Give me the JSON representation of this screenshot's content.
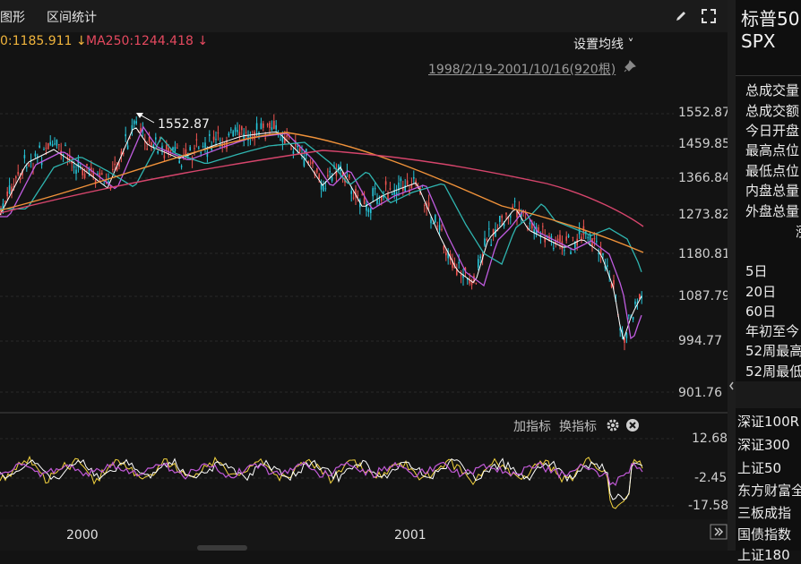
{
  "toolbar": {
    "tab_chart": "图形",
    "tab_range_stats": "区间统计",
    "draw_icon": "pencil-icon",
    "fullscreen_icon": "expand-icon"
  },
  "ma_legend": {
    "ma_prev": "0:1185.911 ↓",
    "ma250": "MA250:1244.418 ↓",
    "ma_prev_color": "#f0b43c",
    "ma250_color": "#e5495f"
  },
  "settings_ma": "设置均线 ˅",
  "date_range": "1998/2/19-2001/10/16(920根)",
  "high_marker": "1552.87",
  "price_axis": [
    "1552.87",
    "1459.85",
    "1366.84",
    "1273.82",
    "1180.81",
    "1087.79",
    "994.77",
    "901.76"
  ],
  "indicator": {
    "add_label": "加指标",
    "switch_label": "换指标",
    "axis": [
      "12.68",
      "-2.45",
      "-17.58"
    ]
  },
  "time_axis": [
    "2000",
    "2001"
  ],
  "right_panel": {
    "title": "标普50",
    "code": "SPX",
    "stats": [
      "总成交量",
      "总成交额",
      "今日开盘",
      "最高点位",
      "最低点位",
      "内盘总量",
      "外盘总量"
    ],
    "ranges": [
      "5日",
      "20日",
      "60日",
      "年初至今",
      "52周最高",
      "52周最低"
    ],
    "indices": [
      "深证100R",
      "深证300",
      "上证50",
      "东方财富全",
      "三板成指",
      "国债指数",
      "上证180"
    ]
  },
  "colors": {
    "up": "#ef5350",
    "down": "#26c6da",
    "ma5": "#ffffff",
    "ma20": "#c05ce0",
    "ma60": "#2fb5b0",
    "ma120": "#f0923a",
    "ma250": "#d6456c",
    "osc1": "#ffffff",
    "osc2": "#f3d33e",
    "osc3": "#c25ad8"
  }
}
